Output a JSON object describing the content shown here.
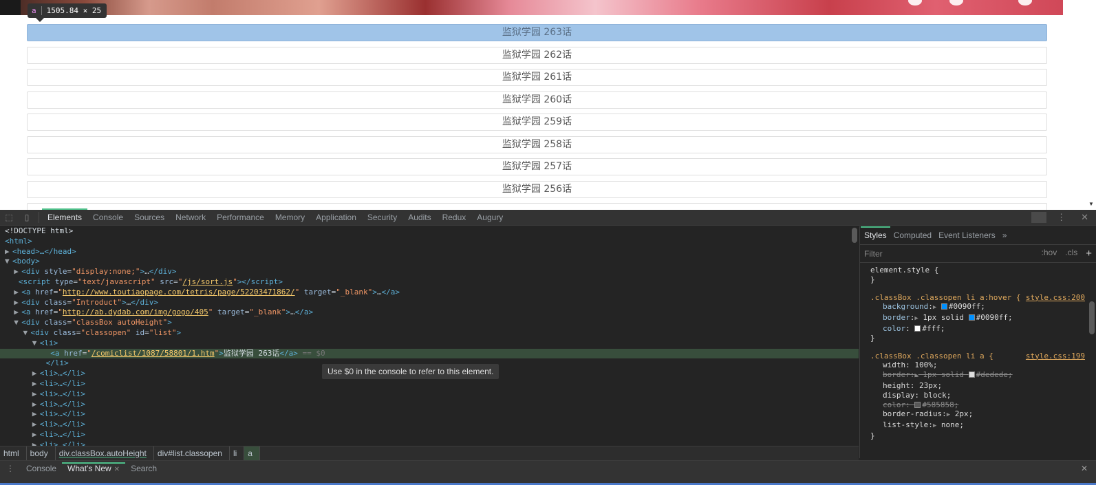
{
  "page": {
    "inspect_tooltip": {
      "tag": "a",
      "size": "1505.84 × 25"
    },
    "chapters": [
      "监狱学园 263话",
      "监狱学园 262话",
      "监狱学园 261话",
      "监狱学园 260话",
      "监狱学园 259话",
      "监狱学园 258话",
      "监狱学园 257话",
      "监狱学园 256话"
    ]
  },
  "devtools": {
    "tabs": [
      "Elements",
      "Console",
      "Sources",
      "Network",
      "Performance",
      "Memory",
      "Application",
      "Security",
      "Audits",
      "Redux",
      "Augury"
    ],
    "active_tab": "Elements",
    "tooltip": "Use $0 in the console to refer to this element.",
    "dom": {
      "doctype": "<!DOCTYPE html>",
      "html_open": "<html>",
      "head": "<head>…</head>",
      "body_open": "<body>",
      "div_none_open": "<div style=\"display:none;\">…</div>",
      "script_src": "/js/sort.js",
      "a1_href": "http://www.toutiaopage.com/tetris/page/52203471862/",
      "introduct": "<div class=\"Introduct\">…</div>",
      "a2_href": "http://ab.dydab.com/img/gogo/405",
      "classbox": "classBox autoHeight",
      "classopen": "classopen",
      "list_id": "list",
      "selected_href": "/comiclist/1087/58801/1.htm",
      "selected_text": "监狱学园 263话",
      "dollar0": "== $0",
      "li_collapsed": "<li>…</li>"
    },
    "styles_tabs": [
      "Styles",
      "Computed",
      "Event Listeners"
    ],
    "filter_placeholder": "Filter",
    "hov": ":hov",
    "cls": ".cls",
    "rules": {
      "element_style": "element.style {",
      "rule1_selector": ".classBox .classopen li a:hover {",
      "rule1_source": "style.css:200",
      "rule1_props": [
        {
          "name": "background",
          "value": "#0090ff;",
          "swatch": "#0090ff"
        },
        {
          "name": "border",
          "value": "1px solid #0090ff;",
          "swatch": "#0090ff"
        },
        {
          "name": "color",
          "value": "#fff;",
          "swatch": "#ffffff"
        }
      ],
      "rule2_selector": ".classBox .classopen li a {",
      "rule2_source": "style.css:199",
      "rule2_props": {
        "width": "width: 100%;",
        "border": "border: 1px solid #dedede;",
        "height": "height: 23px;",
        "display": "display: block;",
        "color": "color: #585858;",
        "radius": "border-radius: 2px;",
        "list_style": "list-style: none;"
      }
    },
    "breadcrumbs": [
      "html",
      "body",
      "div.classBox.autoHeight",
      "div#list.classopen",
      "li",
      "a"
    ],
    "drawer_tabs": [
      "Console",
      "What's New",
      "Search"
    ]
  }
}
